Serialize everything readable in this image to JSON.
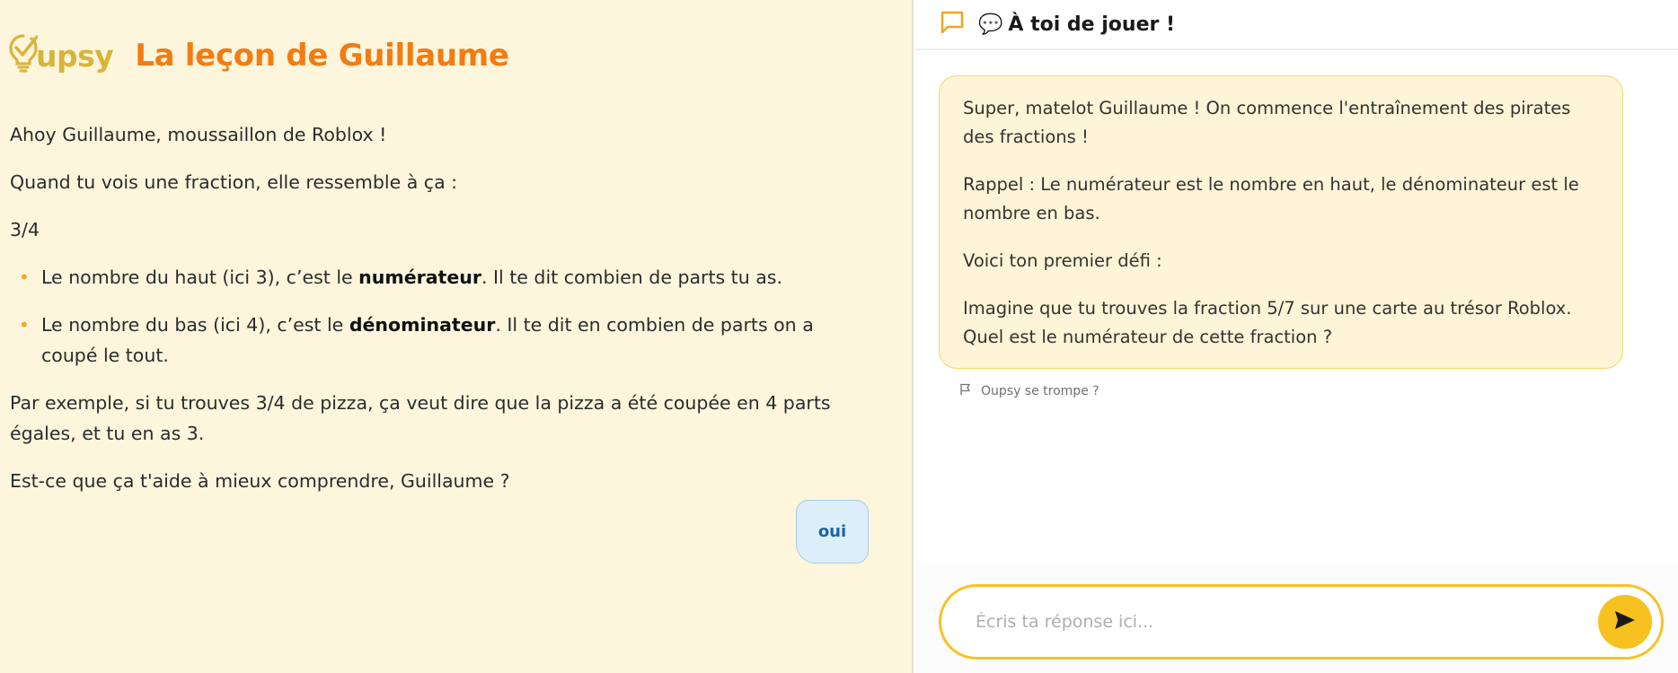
{
  "lesson": {
    "brand": "upsy",
    "title": "La leçon de Guillaume",
    "intro": "Ahoy Guillaume, moussaillon de Roblox !",
    "lead": "Quand tu vois une fraction, elle ressemble à ça :",
    "example_fraction": "3/4",
    "bullets": [
      {
        "before": "Le nombre du haut (ici 3), c’est le ",
        "bold": "numérateur",
        "after": ". Il te dit combien de parts tu as."
      },
      {
        "before": "Le nombre du bas (ici 4), c’est le ",
        "bold": "dénominateur",
        "after": ". Il te dit en combien de parts on a coupé le tout."
      }
    ],
    "example_text": "Par exemple, si tu trouves 3/4 de pizza, ça veut dire que la pizza a été coupée en 4 parts égales, et tu en as 3.",
    "question": "Est-ce que ça t'aide à mieux comprendre, Guillaume ?",
    "answer_label": "oui"
  },
  "chat": {
    "header_emoji": "💬",
    "header_title": "À toi de jouer !",
    "message": [
      "Super, matelot Guillaume ! On commence l'entraînement des pirates des fractions !",
      "Rappel : Le numérateur est le nombre en haut, le dénominateur est le nombre en bas.",
      "Voici ton premier défi :",
      "Imagine que tu trouves la fraction 5/7 sur une carte au trésor Roblox. Quel est le numérateur de cette fraction ?"
    ],
    "report_label": "Oupsy se trompe ?",
    "input_placeholder": "Écris ta réponse ici...",
    "input_value": ""
  },
  "icons": {
    "logo": "lightbulb-check-icon",
    "chat": "chat-bubble-icon",
    "report": "flag-icon",
    "send": "send-arrow-icon"
  },
  "colors": {
    "accent_orange": "#f27c12",
    "logo_gold": "#d9b43a",
    "send_yellow": "#f7c21f",
    "input_border": "#f6c326",
    "left_bg": "#fdf6dd",
    "message_bg": "#fef4d7",
    "answer_bg": "#dceefa",
    "answer_text": "#1e63a8"
  }
}
